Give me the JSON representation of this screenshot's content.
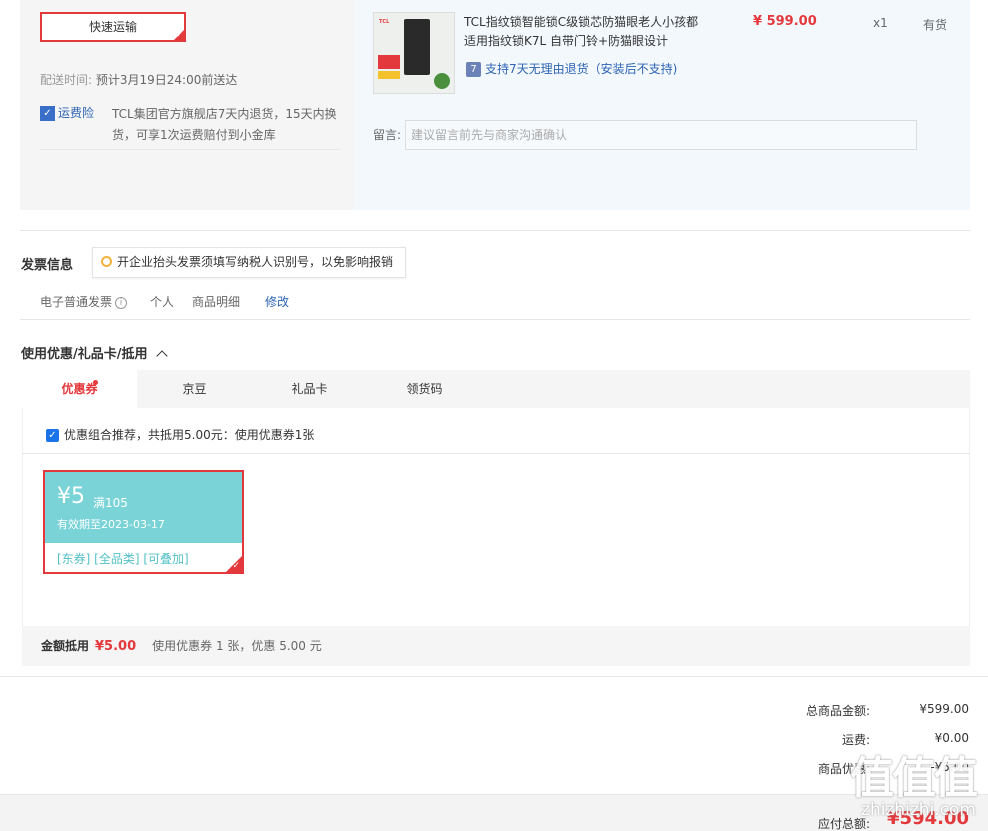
{
  "shipping": {
    "method_label": "快速运输",
    "delivery_time_label": "配送时间:",
    "delivery_time_value": "预计3月19日24:00前送达",
    "insurance_label": "运费险",
    "insurance_desc_line1": "TCL集团官方旗舰店7天内退货，15天内换",
    "insurance_desc_line2": "货，可享1次运费赔付到小金库"
  },
  "product": {
    "image_brand": "TCL",
    "title_line1": "TCL指纹锁智能锁C级锁芯防猫眼老人小孩都",
    "title_line2": "适用指纹锁K7L 自带门铃+防猫眼设计",
    "price": "¥ 599.00",
    "quantity": "x1",
    "stock": "有货",
    "return_policy": "支持7天无理由退货（安装后不支持)",
    "note_label": "留言:",
    "note_placeholder": "建议留言前先与商家沟通确认"
  },
  "invoice": {
    "title": "发票信息",
    "tip": "开企业抬头发票须填写纳税人识别号，以免影响报销",
    "type": "电子普通发票",
    "holder": "个人",
    "content": "商品明细",
    "edit_link": "修改"
  },
  "coupons": {
    "title": "使用优惠/礼品卡/抵用",
    "tabs": [
      "优惠券",
      "京豆",
      "礼品卡",
      "领货码"
    ],
    "combo_text": "优惠组合推荐，共抵用5.00元：使用优惠券1张",
    "coupon": {
      "amount": "¥5",
      "condition": "满105",
      "expiry": "有效期至2023-03-17",
      "tags": "[东券]  [全品类]  [可叠加]"
    },
    "summary_label": "金额抵用",
    "summary_amount": "¥5.00",
    "summary_desc": "使用优惠券 1 张，优惠 5.00 元"
  },
  "totals": {
    "goods_label": "总商品金额:",
    "goods_value": "¥599.00",
    "shipping_label": "运费:",
    "shipping_value": "¥0.00",
    "discount_label": "商品优惠:",
    "discount_value": "-¥5.00",
    "payable_label": "应付总额:",
    "payable_value": "¥594.00"
  },
  "watermark": {
    "logo_text": "值值值",
    "site_text": "zhizhizhi.com"
  },
  "colors": {
    "accent_red": "#e4393c",
    "link_blue": "#2d64b3",
    "coupon_teal": "#79d3d7"
  }
}
